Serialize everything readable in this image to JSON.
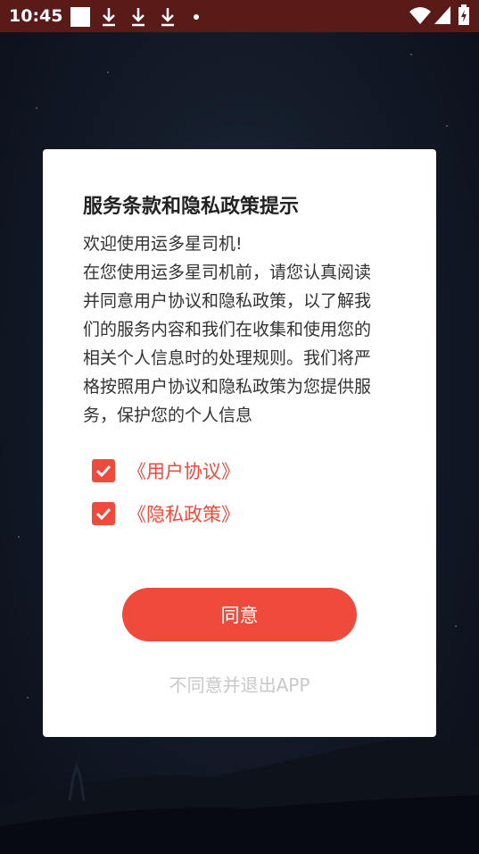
{
  "status_bar": {
    "time": "10:45",
    "left_icons": [
      "square-notification-icon",
      "download-icon",
      "download-icon",
      "download-icon",
      "dot-icon"
    ],
    "right_icons": [
      "wifi-icon",
      "signal-icon",
      "battery-charging-icon"
    ]
  },
  "dialog": {
    "title": "服务条款和隐私政策提示",
    "body": "欢迎使用运多星司机!\n在您使用运多星司机前，请您认真阅读并同意用户协议和隐私政策，以了解我们的服务内容和我们在收集和使用您的相关个人信息时的处理规则。我们将严格按照用户协议和隐私政策为您提供服务，保护您的个人信息",
    "agreements": [
      {
        "label": "《用户协议》",
        "checked": true
      },
      {
        "label": "《隐私政策》",
        "checked": true
      }
    ],
    "agree_button": "同意",
    "decline_link": "不同意并退出APP"
  },
  "colors": {
    "accent": "#f04a3c",
    "status_bar": "#5a1a18",
    "decline_text": "#c8c8c8"
  }
}
